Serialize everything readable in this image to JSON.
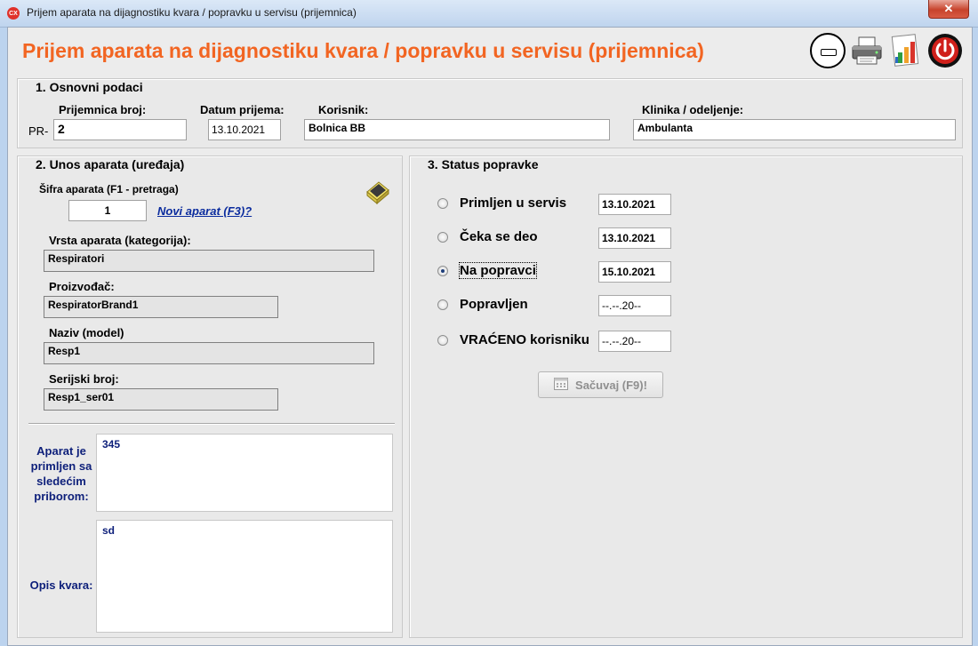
{
  "window": {
    "title": "Prijem aparata na dijagnostiku kvara / popravku u servisu (prijemnica)",
    "app_icon_text": "CX",
    "close_glyph": "✕"
  },
  "header": {
    "title": "Prijem aparata na dijagnostiku kvara / popravku u servisu (prijemnica)",
    "icons": [
      "minimize-icon",
      "printer-icon",
      "report-chart-icon",
      "power-icon"
    ]
  },
  "section1": {
    "title": "1. Osnovni podaci",
    "receipt_label": "Prijemnica broj:",
    "receipt_prefix": "PR-",
    "receipt_number": "2",
    "date_label": "Datum prijema:",
    "date_value": "13.10.2021",
    "client_label": "Korisnik:",
    "client_value": "Bolnica BB",
    "clinic_label": "Klinika / odeljenje:",
    "clinic_value": "Ambulanta"
  },
  "section2": {
    "title": "2. Unos aparata (uređaja)",
    "code_label": "Šifra aparata (F1 - pretraga)",
    "code_value": "1",
    "new_device_link": "Novi aparat (F3)?",
    "type_label": "Vrsta aparata (kategorija):",
    "type_value": "Respiratori",
    "manufacturer_label": "Proizvođač:",
    "manufacturer_value": "RespiratorBrand1",
    "model_label": "Naziv (model)",
    "model_value": "Resp1",
    "serial_label": "Serijski broj:",
    "serial_value": "Resp1_ser01",
    "accessories_label": "Aparat je primljen sa sledećim priborom:",
    "accessories_value": "345",
    "fault_label": "Opis kvara:",
    "fault_value": "sd"
  },
  "section3": {
    "title": "3. Status popravke",
    "statuses": [
      {
        "label": "Primljen u servis",
        "date": "13.10.2021",
        "checked": false
      },
      {
        "label": "Čeka se deo",
        "date": "13.10.2021",
        "checked": false
      },
      {
        "label": "Na popravci",
        "date": "15.10.2021",
        "checked": true
      },
      {
        "label": "Popravljen",
        "date": "--.--.20--",
        "checked": false
      },
      {
        "label": "VRAĆENO korisniku",
        "date": "--.--.20--",
        "checked": false
      }
    ],
    "save_button": "Sačuvaj (F9)!"
  },
  "colors": {
    "title_orange": "#f26522",
    "link_blue": "#0b2c9e",
    "note_navy": "#0d1f7a"
  }
}
